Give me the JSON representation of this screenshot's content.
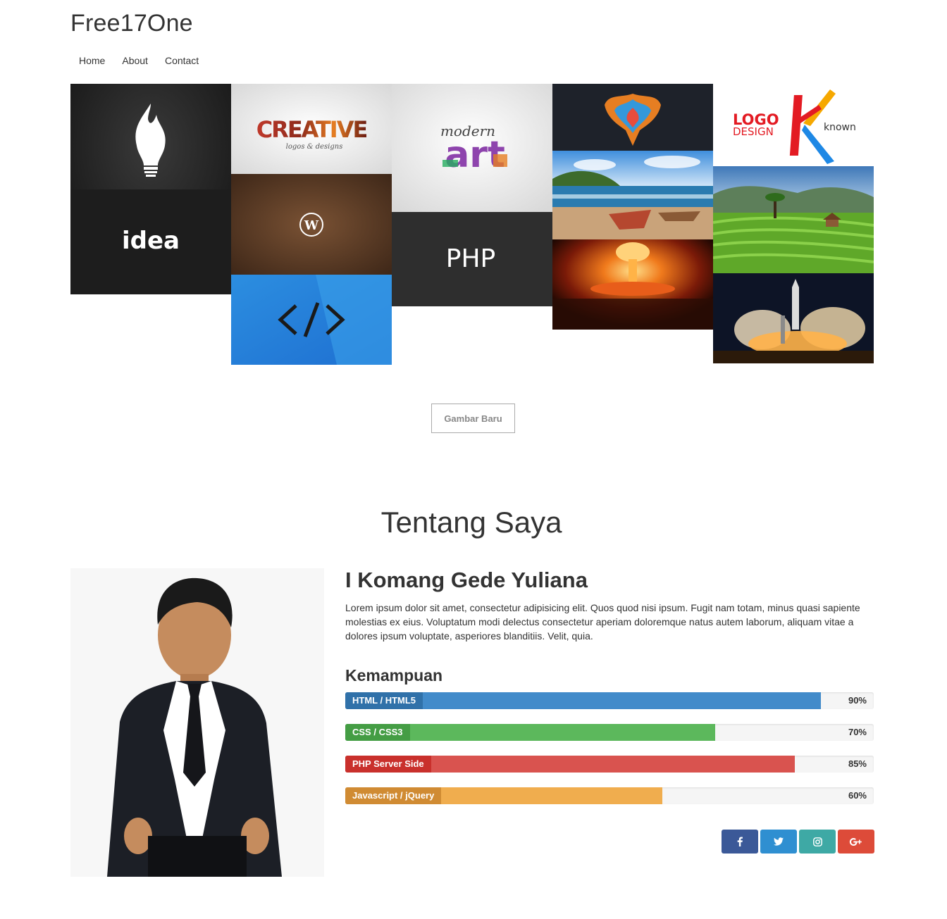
{
  "header": {
    "brand": "Free17One",
    "nav": [
      "Home",
      "About",
      "Contact"
    ]
  },
  "gallery": {
    "tiles": [
      {
        "name": "idea",
        "text": "idea"
      },
      {
        "name": "creative",
        "text": "CREATIVE",
        "subtext": "logos & designs"
      },
      {
        "name": "wordpress",
        "text": "W"
      },
      {
        "name": "code",
        "text": ""
      },
      {
        "name": "modern-art",
        "text": "art",
        "subtext": "modern"
      },
      {
        "name": "php",
        "text": "PHP"
      },
      {
        "name": "phoenix",
        "text": ""
      },
      {
        "name": "beach",
        "text": ""
      },
      {
        "name": "explosion",
        "text": ""
      },
      {
        "name": "logo-design",
        "text": "LOGO",
        "subtext": "DESIGN",
        "extra": "known"
      },
      {
        "name": "rice-terrace",
        "text": ""
      },
      {
        "name": "rocket-launch",
        "text": ""
      }
    ],
    "new_button": "Gambar Baru"
  },
  "about": {
    "title": "Tentang Saya",
    "name": "I Komang Gede Yuliana",
    "bio": "Lorem ipsum dolor sit amet, consectetur adipisicing elit. Quos quod nisi ipsum. Fugit nam totam, minus quasi sapiente molestias ex eius. Voluptatum modi delectus consectetur aperiam doloremque natus autem laborum, aliquam vitae a dolores ipsum voluptate, asperiores blanditiis. Velit, quia.",
    "skills_title": "Kemampuan",
    "skills": [
      {
        "label": "HTML / HTML5",
        "percent": 90,
        "pct_text": "90%",
        "color": "#428bca",
        "label_color": "#3071a9"
      },
      {
        "label": "CSS / CSS3",
        "percent": 70,
        "pct_text": "70%",
        "color": "#5cb85c",
        "label_color": "#449d44"
      },
      {
        "label": "PHP Server Side",
        "percent": 85,
        "pct_text": "85%",
        "color": "#d9534f",
        "label_color": "#c9302c"
      },
      {
        "label": "Javascript / jQuery",
        "percent": 60,
        "pct_text": "60%",
        "color": "#f0ad4e",
        "label_color": "#d08b33"
      }
    ],
    "social": [
      {
        "name": "facebook",
        "icon": "facebook-icon",
        "color": "#3b5998"
      },
      {
        "name": "twitter",
        "icon": "twitter-icon",
        "color": "#2f8fd1"
      },
      {
        "name": "instagram",
        "icon": "instagram-icon",
        "color": "#3ea9a5"
      },
      {
        "name": "google-plus",
        "icon": "google-plus-icon",
        "color": "#dd4b39"
      }
    ]
  }
}
